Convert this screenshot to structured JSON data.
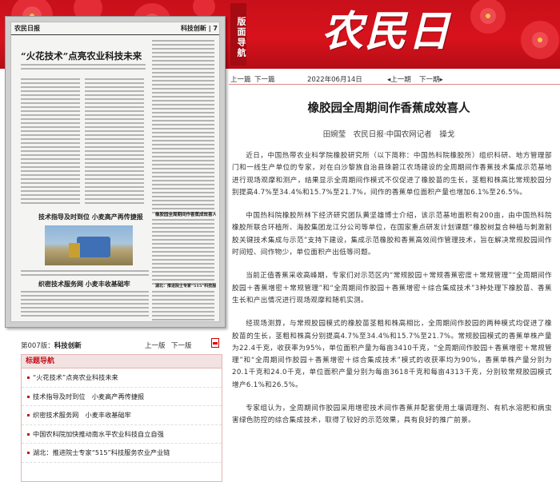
{
  "header": {
    "masthead": "农民日报",
    "edition_nav_label": "版面导航",
    "colors": {
      "banner_red": "#d0121b",
      "accent": "#c3141c"
    }
  },
  "page_thumbnail": {
    "logo": "农民日报",
    "section": "科技创新 | 7",
    "headline": "“火花技术”点亮农业科技未来",
    "headline2": "技术指导及时到位 小麦高产再传捷报",
    "headline3": "织密技术服务网 小麦丰收基础牢",
    "side_headline1": "橡胶园全周期间作香蕉成效喜人",
    "side_headline2": "湖北：推进院士专家“515”科技服务农业产业链"
  },
  "page_nav": {
    "page_label": "第007版：",
    "section_name": "科技创新",
    "prev_page": "上一版",
    "next_page": "下一版",
    "pdf_icon": "pdf-icon"
  },
  "title_nav": {
    "heading": "标题导航",
    "items": [
      "“火花技术”点亮农业科技未来",
      "技术指导及时到位　小麦高产再传捷报",
      "织密技术服务网　小麦丰收基础牢",
      "中国农科院加快推动南水平农业科技自立自强",
      "湖北：推进院士专家“515”科技服务农业产业链"
    ]
  },
  "article_nav": {
    "prev_article": "上一篇",
    "next_article": "下一篇",
    "date": "2022年06月14日",
    "prev_issue": "上一期",
    "next_issue": "下一期"
  },
  "article": {
    "title": "橡胶园全周期间作香蕉成效喜人",
    "byline": "田婉莹　农民日报·中国农网记者　操戈",
    "paragraphs": [
      "近日，中国热带农业科学院橡胶研究所（以下简称：中国热科院橡胶所）组织科研、地方管理部门和一线生产单位的专家，对在白沙黎族自治县珠碧江农场建设的全周期间作香蕉技术集成示范基地进行现场观摩和测产，结果显示全周期间作模式不仅促进了橡胶苗的生长，茎粗和株高比常规胶园分别提高4.7%至34.4%和15.7%至21.7%，间作的香蕉单位面积产量也增加6.1%至26.5%。",
      "中国热科院橡胶所林下经济研究团队黄坚雄博士介绍，该示范基地面积有200亩，由中国热科院橡胶所联合环植所、海胶集团龙江分公司等单位，在国家重点研发计划课题“橡胶树复合种植与刺激割胶关键技术集成与示范”支持下建设，集成示范橡胶和香蕉高效间作管理技术，旨在解决常规胶园间作时间短、间作物少，单位面积产出低等问题。",
      "当前正值香蕉采收高峰期，专家们对示范区内“常规胶园＋常规香蕉密度＋常规管理”“全周期间作胶园＋香蕉增密＋常规管理”和“全周期间作胶园＋香蕉增密＋综合集成技术”3种处理下橡胶苗、香蕉生长和产出情况进行现场观摩和随机实测。",
      "经现场测算，与常规胶园模式的橡胶苗茎粗和株高相比，全周期间作胶园的两种模式均促进了橡胶苗的生长，茎粗和株高分别提高4.7%至34.4%和15.7%至21.7%。常规胶园模式的香蕉单株产量为22.4千克，收获率为95%，单位面积产量为每亩3410千克，“全周期间作胶园＋香蕉增密＋常规管理”和“全周期间作胶园＋香蕉增密＋综合集成技术”模式的收获率均为90%，香蕉单株产量分别为20.1千克和24.0千克，单位面积产量分别为每亩3618千克和每亩4313千克，分别较常规胶园模式增产6.1%和26.5%。",
      "专家组认为，全周期间作胶园采用增密技术间作香蕉并配套使用土壤调理剂、有机水溶肥和病虫害绿色防控的综合集成技术，取得了较好的示范效果，具有良好的推广前景。"
    ]
  }
}
